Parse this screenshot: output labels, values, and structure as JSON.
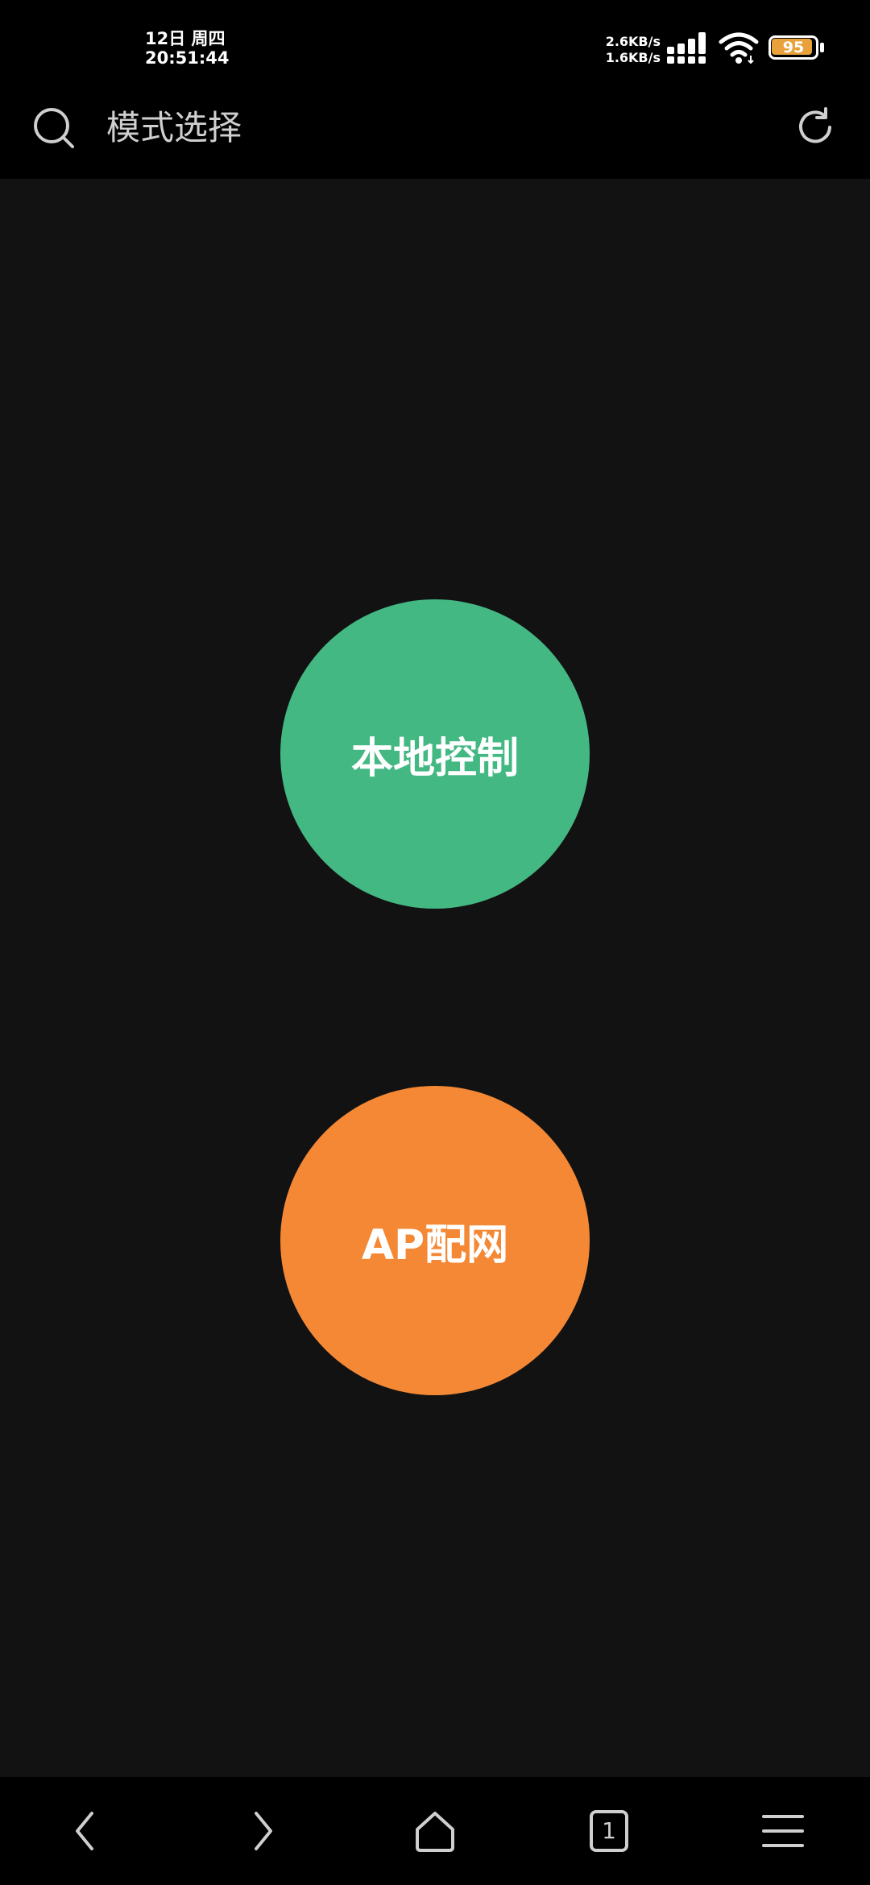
{
  "status_bar": {
    "date": "12日 周四",
    "time": "20:51:44",
    "upload_speed": "2.6KB/s",
    "download_speed": "1.6KB/s",
    "battery_level": "95",
    "battery_color": "#e9a23b"
  },
  "app_bar": {
    "title": "模式选择",
    "left_icon": "search-icon",
    "right_icon": "refresh-icon"
  },
  "modes": {
    "local_control": {
      "label": "本地控制",
      "color": "#43b883"
    },
    "ap_config": {
      "label": "AP配网",
      "color": "#f48835"
    }
  },
  "bottom_nav": {
    "items": [
      "back-icon",
      "forward-icon",
      "home-icon",
      "tabs-icon",
      "menu-icon"
    ],
    "tab_count": "1"
  }
}
